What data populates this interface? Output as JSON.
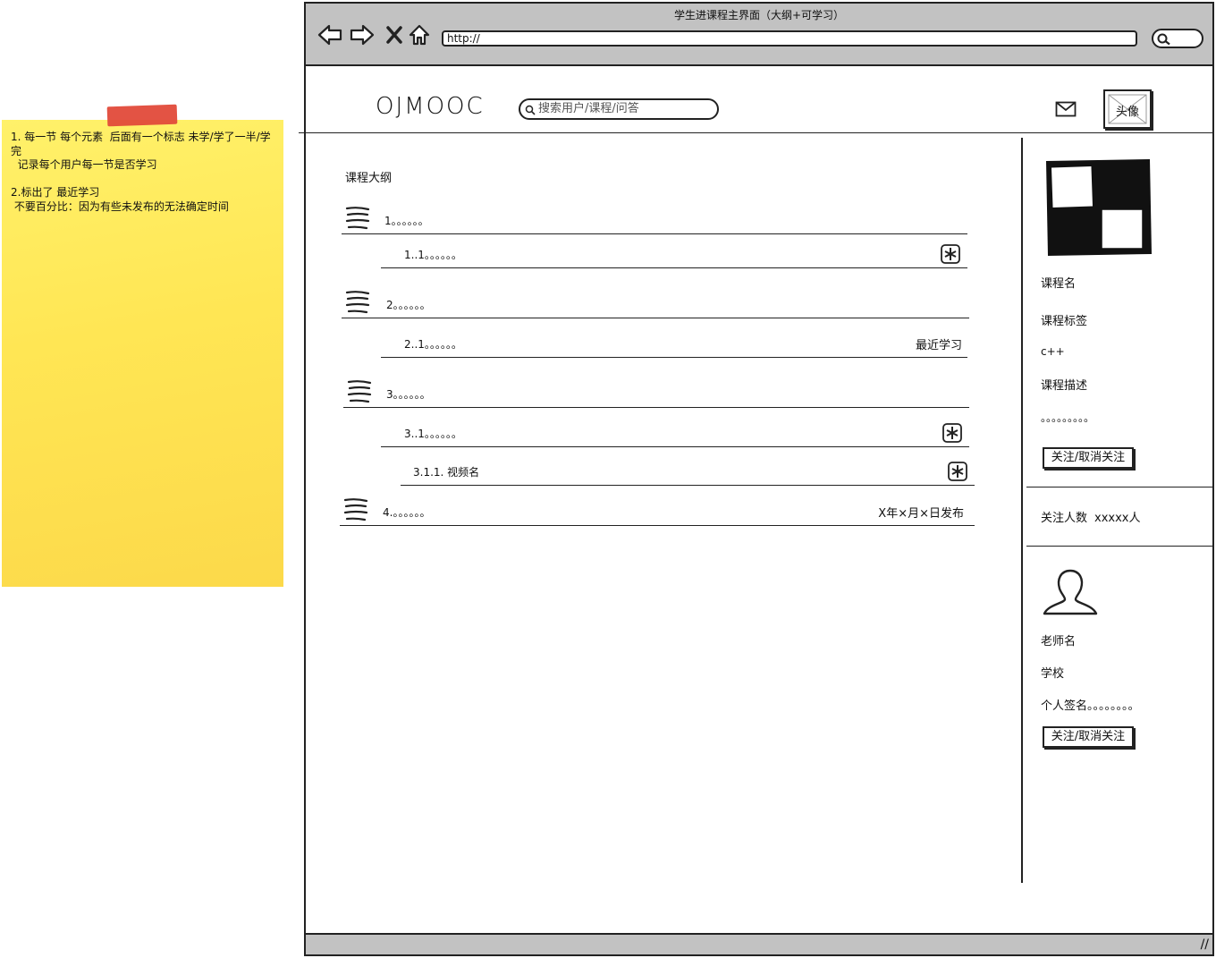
{
  "sticky_note": {
    "text": "1. 每一节 每个元素  后面有一个标志 未学/学了一半/学完\n  记录每个用户每一节是否学习\n\n2.标出了 最近学习\n 不要百分比：因为有些未发布的无法确定时间"
  },
  "browser": {
    "title": "学生进课程主界面（大纲+可学习）",
    "url": "http://"
  },
  "header": {
    "logo": "OJMOOC",
    "search_placeholder": "搜索用户/课程/问答",
    "avatar_label": "头像"
  },
  "outline": {
    "title": "课程大纲",
    "rows": [
      {
        "label": "1。。。。。。",
        "kind": "chapter"
      },
      {
        "label": "1..1。。。。。。",
        "kind": "section",
        "marker": "asterisk-icon"
      },
      {
        "label": "2。。。。。。",
        "kind": "chapter"
      },
      {
        "label": "2..1。。。。。。",
        "kind": "section",
        "right_text": "最近学习"
      },
      {
        "label": "3。。。。。。",
        "kind": "chapter"
      },
      {
        "label": "3..1。。。。。。",
        "kind": "section",
        "marker": "asterisk-icon"
      },
      {
        "label": "3.1.1. 视频名",
        "kind": "video",
        "marker": "asterisk-icon"
      },
      {
        "label": "4.。。。。。。",
        "kind": "chapter",
        "right_text": "X年×月×日发布"
      }
    ]
  },
  "course": {
    "name_label": "课程名",
    "tag_label": "课程标签",
    "tag_value": "c++",
    "desc_label": "课程描述",
    "desc_value": "。。。。。。。。。",
    "follow_label": "关注/取消关注",
    "followers_label": "关注人数",
    "followers_value": "xxxxx人"
  },
  "teacher": {
    "name_label": "老师名",
    "school_label": "学校",
    "signature_label": "个人签名。。。。。。。。",
    "follow_label": "关注/取消关注"
  }
}
